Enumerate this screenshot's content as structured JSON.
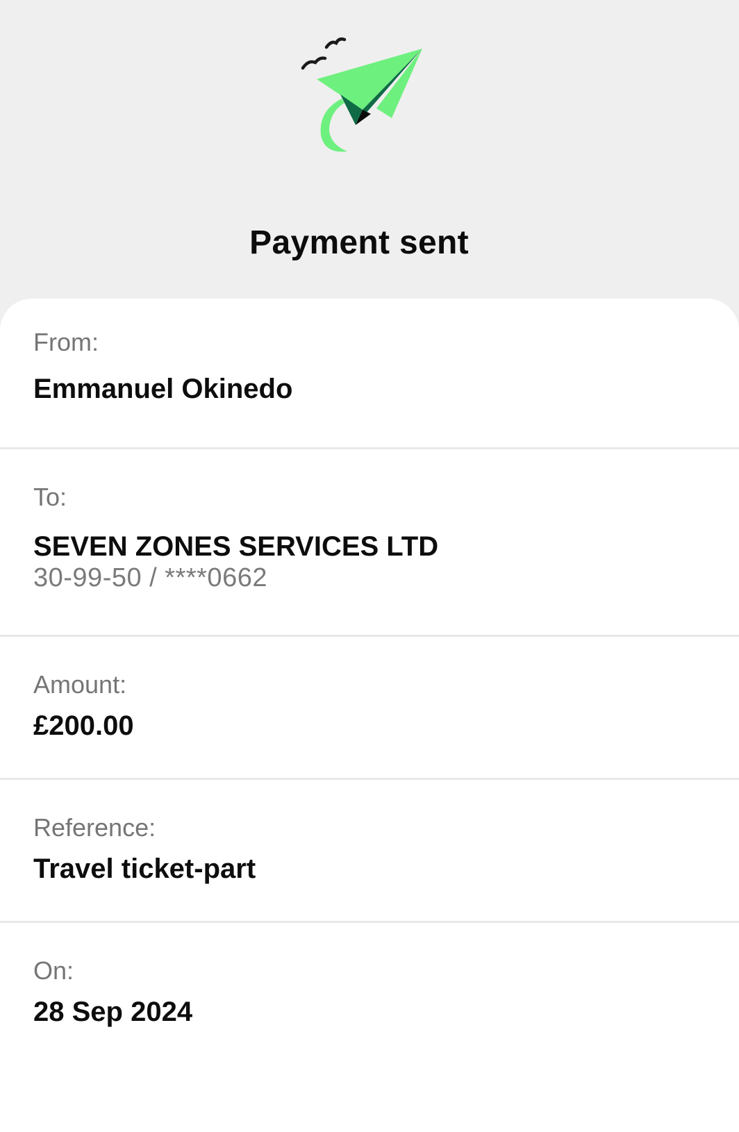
{
  "header": {
    "title": "Payment sent",
    "illustration": "paper-plane-with-birds",
    "colors": {
      "plane_light": "#6ef07f",
      "plane_dark": "#0f6b45",
      "birds": "#1a1a1a"
    }
  },
  "details": [
    {
      "label": "From:",
      "value": "Emmanuel Okinedo"
    },
    {
      "label": "To:",
      "value": "SEVEN ZONES SERVICES LTD",
      "sub": "30-99-50 / ****0662"
    },
    {
      "label": "Amount:",
      "value": "£200.00"
    },
    {
      "label": "Reference:",
      "value": "Travel ticket-part"
    },
    {
      "label": "On:",
      "value": "28 Sep 2024"
    }
  ]
}
